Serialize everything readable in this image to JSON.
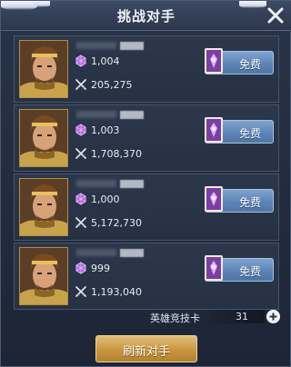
{
  "header": {
    "title": "挑战对手"
  },
  "opponents": [
    {
      "rank": "1,004",
      "power": "205,275",
      "button": "免费"
    },
    {
      "rank": "1,003",
      "power": "1,708,370",
      "button": "免费"
    },
    {
      "rank": "1,000",
      "power": "5,172,730",
      "button": "免费"
    },
    {
      "rank": "999",
      "power": "1,193,040",
      "button": "免费"
    }
  ],
  "footer": {
    "cards_label": "英雄竞技卡",
    "cards_count": "31",
    "refresh_label": "刷新对手"
  },
  "icons": {
    "close": "close-icon",
    "rank": "purple-gem-icon",
    "power": "crossed-swords-icon",
    "ticket": "purple-book-icon",
    "add": "plus-icon"
  },
  "colors": {
    "free_button": "#5d84b4",
    "refresh_button": "#c9963f",
    "portrait_frame": "#b88b3a"
  }
}
